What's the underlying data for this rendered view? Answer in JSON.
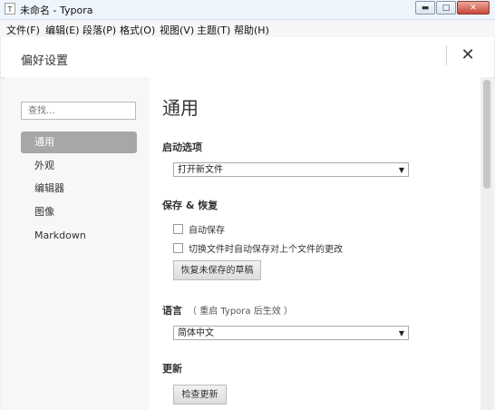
{
  "window": {
    "title": "未命名 - Typora",
    "icon_text": "T",
    "buttons": [
      "minimize-icon",
      "maximize-icon",
      "close-icon"
    ]
  },
  "menubar": [
    "文件(F)",
    "编辑(E)",
    "段落(P)",
    "格式(O)",
    "视图(V)",
    "主题(T)",
    "帮助(H)"
  ],
  "prefs": {
    "title": "偏好设置",
    "close_symbol": "✕",
    "search_placeholder": "查找...",
    "nav": [
      "通用",
      "外观",
      "编辑器",
      "图像",
      "Markdown"
    ],
    "active_nav": "通用"
  },
  "general": {
    "heading": "通用",
    "startup": {
      "label": "启动选项",
      "selected": "打开新文件"
    },
    "save": {
      "label": "保存 & 恢复",
      "autosave": "自动保存",
      "autosave_on_switch": "切换文件时自动保存对上个文件的更改",
      "recover_button": "恢复未保存的草稿"
    },
    "language": {
      "label": "语言",
      "note": "（ 重启 Typora 后生效 ）",
      "selected": "简体中文"
    },
    "update": {
      "label": "更新",
      "button": "检查更新"
    }
  },
  "colors": {
    "active_nav_bg": "#a7a7a7",
    "titlebar_bg": "#eef5fc"
  }
}
